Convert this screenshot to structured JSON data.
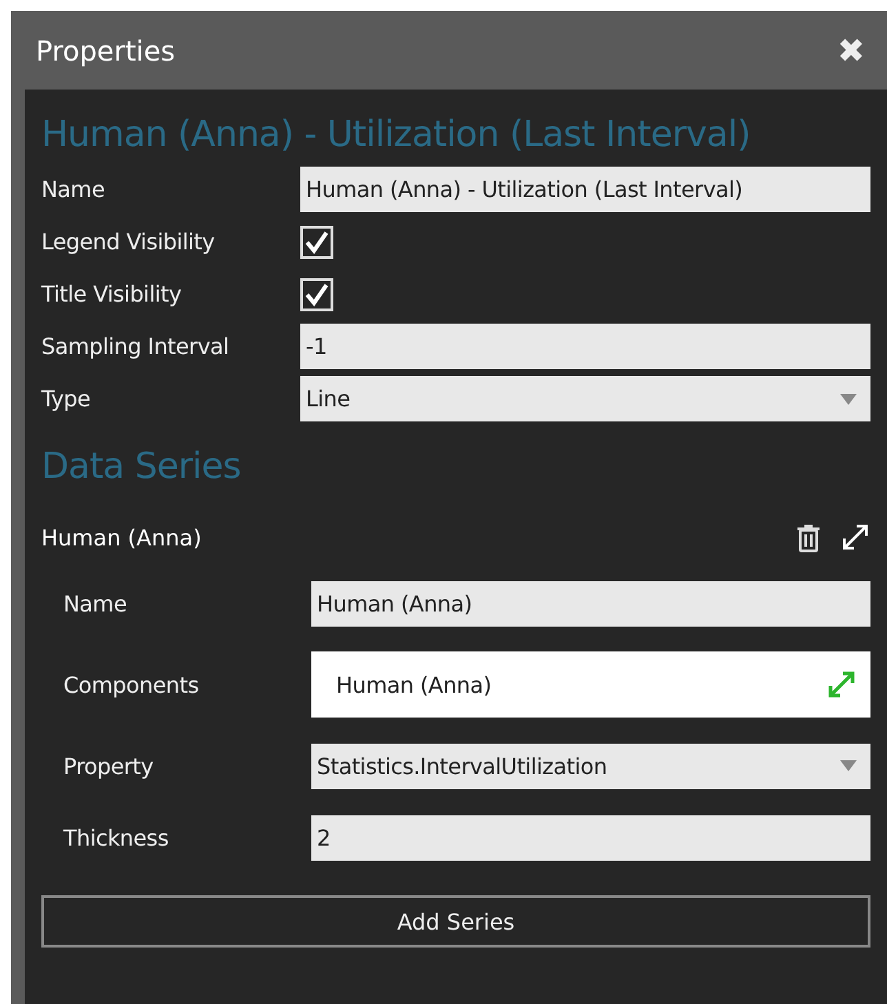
{
  "window": {
    "title": "Properties",
    "close_glyph": "✖"
  },
  "chart": {
    "heading": "Human (Anna) - Utilization (Last Interval)",
    "fields": [
      {
        "kind": "text",
        "label": "Name",
        "value": "Human (Anna) - Utilization (Last Interval)"
      },
      {
        "kind": "checkbox",
        "label": "Legend Visibility",
        "checked": true
      },
      {
        "kind": "checkbox",
        "label": "Title Visibility",
        "checked": true
      },
      {
        "kind": "text",
        "label": "Sampling Interval",
        "value": "-1"
      },
      {
        "kind": "dropdown",
        "label": "Type",
        "value": "Line"
      }
    ]
  },
  "data_series": {
    "heading": "Data Series",
    "series": [
      {
        "name": "Human (Anna)",
        "fields": [
          {
            "kind": "text",
            "label": "Name",
            "value": "Human (Anna)"
          },
          {
            "kind": "picker",
            "label": "Components",
            "value": "Human (Anna)"
          },
          {
            "kind": "dropdown",
            "label": "Property",
            "value": "Statistics.IntervalUtilization"
          },
          {
            "kind": "text",
            "label": "Thickness",
            "value": "2"
          }
        ]
      }
    ],
    "add_button": "Add Series"
  }
}
